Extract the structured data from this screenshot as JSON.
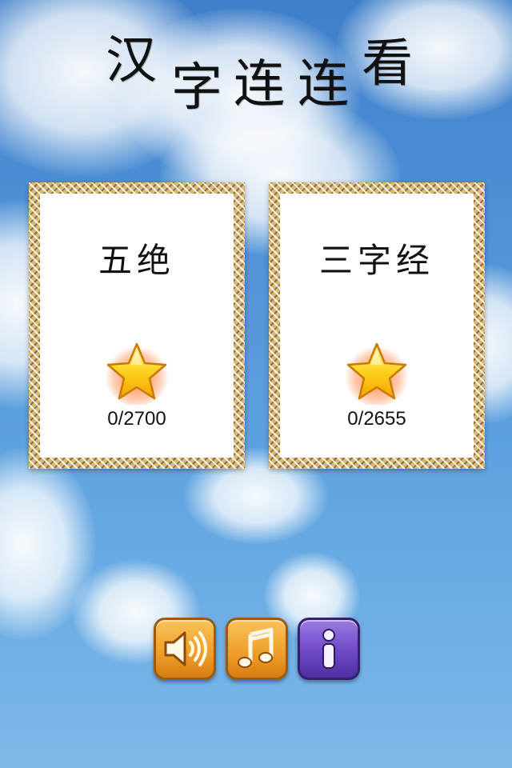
{
  "title": {
    "chars": [
      "汉",
      "字",
      "连",
      "连",
      "看"
    ]
  },
  "cards": [
    {
      "title": "五绝",
      "score": "0/2700",
      "icon": "star-icon"
    },
    {
      "title": "三字经",
      "score": "0/2655",
      "icon": "star-icon"
    }
  ],
  "buttons": [
    {
      "icon": "speaker-icon",
      "color": "#f0a02a"
    },
    {
      "icon": "music-note-icon",
      "color": "#f0a02a"
    },
    {
      "icon": "info-icon",
      "color": "#6f48c8"
    }
  ]
}
